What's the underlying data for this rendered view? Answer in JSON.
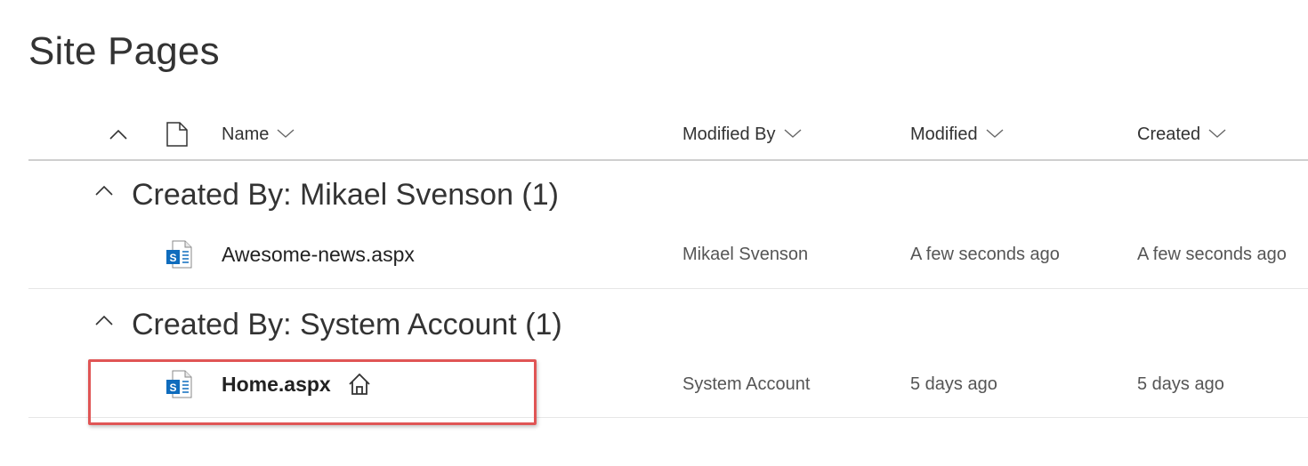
{
  "page": {
    "title": "Site Pages"
  },
  "columns": {
    "name": "Name",
    "modified_by": "Modified By",
    "modified": "Modified",
    "created": "Created"
  },
  "groups": [
    {
      "label": "Created By: Mikael Svenson (1)",
      "rows": [
        {
          "name": "Awesome-news.aspx",
          "modified_by": "Mikael Svenson",
          "modified": "A few seconds ago",
          "created": "A few seconds ago",
          "is_home": false
        }
      ]
    },
    {
      "label": "Created By: System Account (1)",
      "rows": [
        {
          "name": "Home.aspx",
          "modified_by": "System Account",
          "modified": "5 days ago",
          "created": "5 days ago",
          "is_home": true
        }
      ]
    }
  ],
  "icons": {
    "collapse_all": "chevron-up-icon",
    "file_type": "document-icon",
    "sort": "chevron-down-icon",
    "page_file": "sharepoint-page-icon",
    "home": "home-icon"
  },
  "colors": {
    "sharepoint_blue": "#0f6cbd",
    "highlight": "#e05555"
  }
}
